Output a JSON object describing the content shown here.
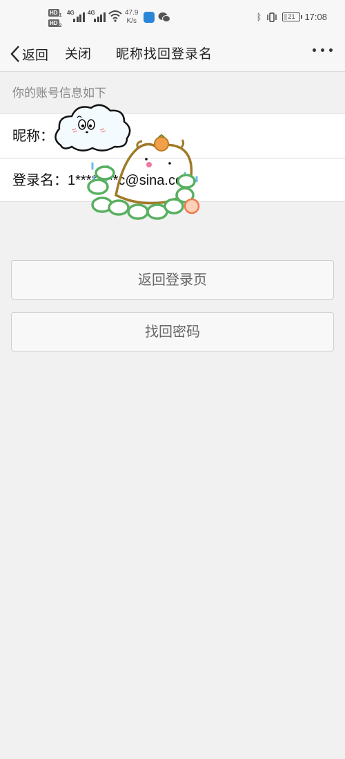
{
  "status_bar": {
    "hd_badge": "HD",
    "sim1_index": "1",
    "sim2_index": "2",
    "network1": "4G",
    "network2": "4G",
    "speed_value": "47.9",
    "speed_unit": "K/s",
    "battery_level": "21",
    "time": "17:08"
  },
  "nav": {
    "back_label": "返回",
    "close_label": "关闭",
    "title": "昵称找回登录名"
  },
  "section": {
    "header": "你的账号信息如下"
  },
  "info": {
    "nickname_label": "昵称：",
    "nickname_value": "",
    "login_label": "登录名：",
    "login_value": "1********c@sina.com"
  },
  "buttons": {
    "back_to_login": "返回登录页",
    "recover_password": "找回密码"
  },
  "colors": {
    "background": "#f1f1f1",
    "bar_background": "#f7f7f7",
    "panel": "#ffffff",
    "muted_text": "#888888",
    "button_text": "#666666"
  }
}
